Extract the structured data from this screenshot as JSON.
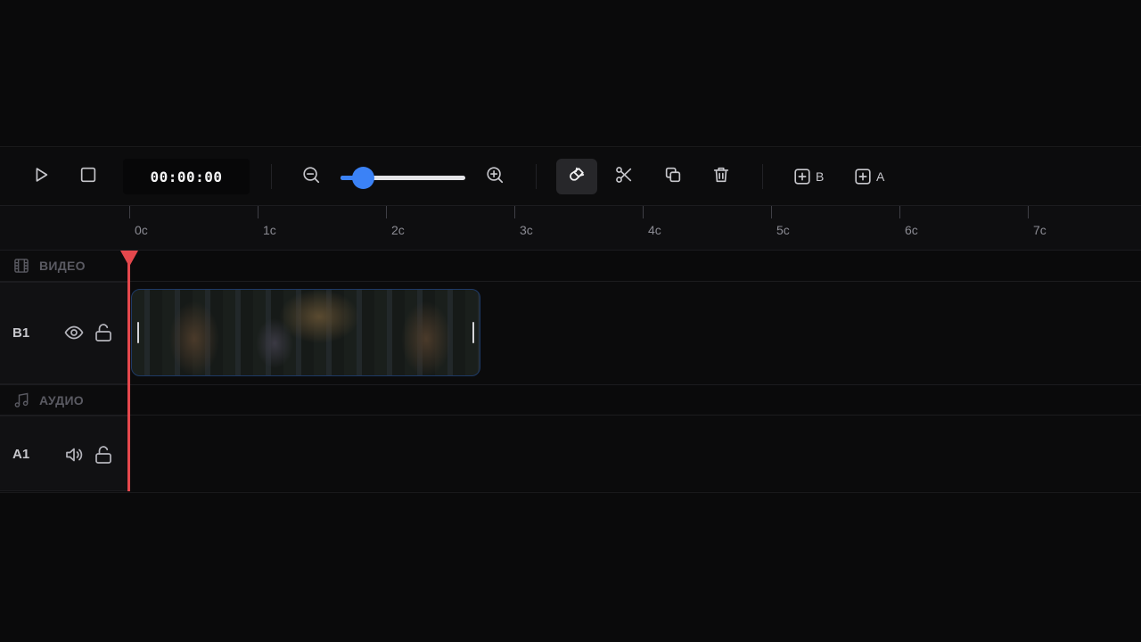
{
  "toolbar": {
    "play": "play-icon",
    "stop": "stop-icon",
    "timecode": "00:00:00",
    "zoom_out": "zoom-out-icon",
    "zoom_in": "zoom-in-icon",
    "zoom_level": 0.18,
    "snap": "magnet-icon",
    "split": "scissors-icon",
    "duplicate": "copy-icon",
    "delete": "trash-icon",
    "add_video_track_label": "B",
    "add_audio_track_label": "A"
  },
  "ruler": {
    "ticks": [
      "0с",
      "1с",
      "2с",
      "3с",
      "4с",
      "5с",
      "6с",
      "7с"
    ]
  },
  "groups": {
    "video": {
      "label": "ВИДЕО",
      "icon": "film-icon"
    },
    "audio": {
      "label": "АУДИО",
      "icon": "music-note-icon"
    }
  },
  "tracks": {
    "video": {
      "name": "В1",
      "visibility_icon": "eye-icon",
      "lock_icon": "unlock-icon"
    },
    "audio": {
      "name": "А1",
      "volume_icon": "speaker-icon",
      "lock_icon": "unlock-icon"
    }
  },
  "colors": {
    "accent": "#3b82f6",
    "playhead": "#e5484d",
    "background": "#0a0a0b"
  }
}
